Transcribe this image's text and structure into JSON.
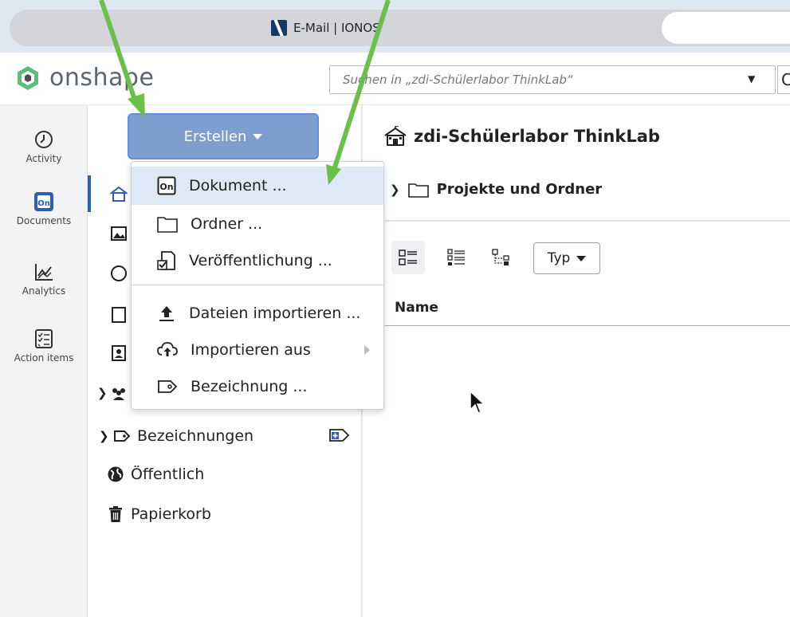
{
  "browser": {
    "tab_title": "E-Mail | IONOS",
    "favicon": "ionos-favicon"
  },
  "app": {
    "logo_text": "onshape",
    "search_placeholder": "Suchen in „zdi-Schülerlabor ThinkLab“",
    "accent_color": "#2b5fb8",
    "logo_color": "#5bbf7a"
  },
  "rail": {
    "items": [
      {
        "label": "Activity",
        "icon": "clock-icon"
      },
      {
        "label": "Documents",
        "icon": "onshape-document-icon"
      },
      {
        "label": "Analytics",
        "icon": "chart-icon"
      },
      {
        "label": "Action items",
        "icon": "checklist-icon"
      }
    ]
  },
  "nav": {
    "create_label": "Erstellen",
    "items": [
      {
        "label": "Bezeichnungen",
        "icon": "tag-icon"
      },
      {
        "label": "Öffentlich",
        "icon": "globe-icon"
      },
      {
        "label": "Papierkorb",
        "icon": "trash-icon"
      }
    ]
  },
  "menu": {
    "items": [
      {
        "label": "Dokument ...",
        "icon": "onshape-document-icon",
        "highlighted": true
      },
      {
        "label": "Ordner ...",
        "icon": "folder-icon"
      },
      {
        "label": "Veröffentlichung ...",
        "icon": "publication-icon"
      },
      {
        "label": "Dateien importieren ...",
        "icon": "upload-icon"
      },
      {
        "label": "Importieren aus",
        "icon": "cloud-upload-icon",
        "has_submenu": true
      },
      {
        "label": "Bezeichnung ...",
        "icon": "tag-icon"
      }
    ]
  },
  "main": {
    "title": "zdi-Schülerlabor ThinkLab",
    "folder_row": "Projekte und Ordner",
    "type_filter": "Typ",
    "column_name": "Name"
  },
  "annotation": {
    "arrow_color": "#6cc04a"
  }
}
